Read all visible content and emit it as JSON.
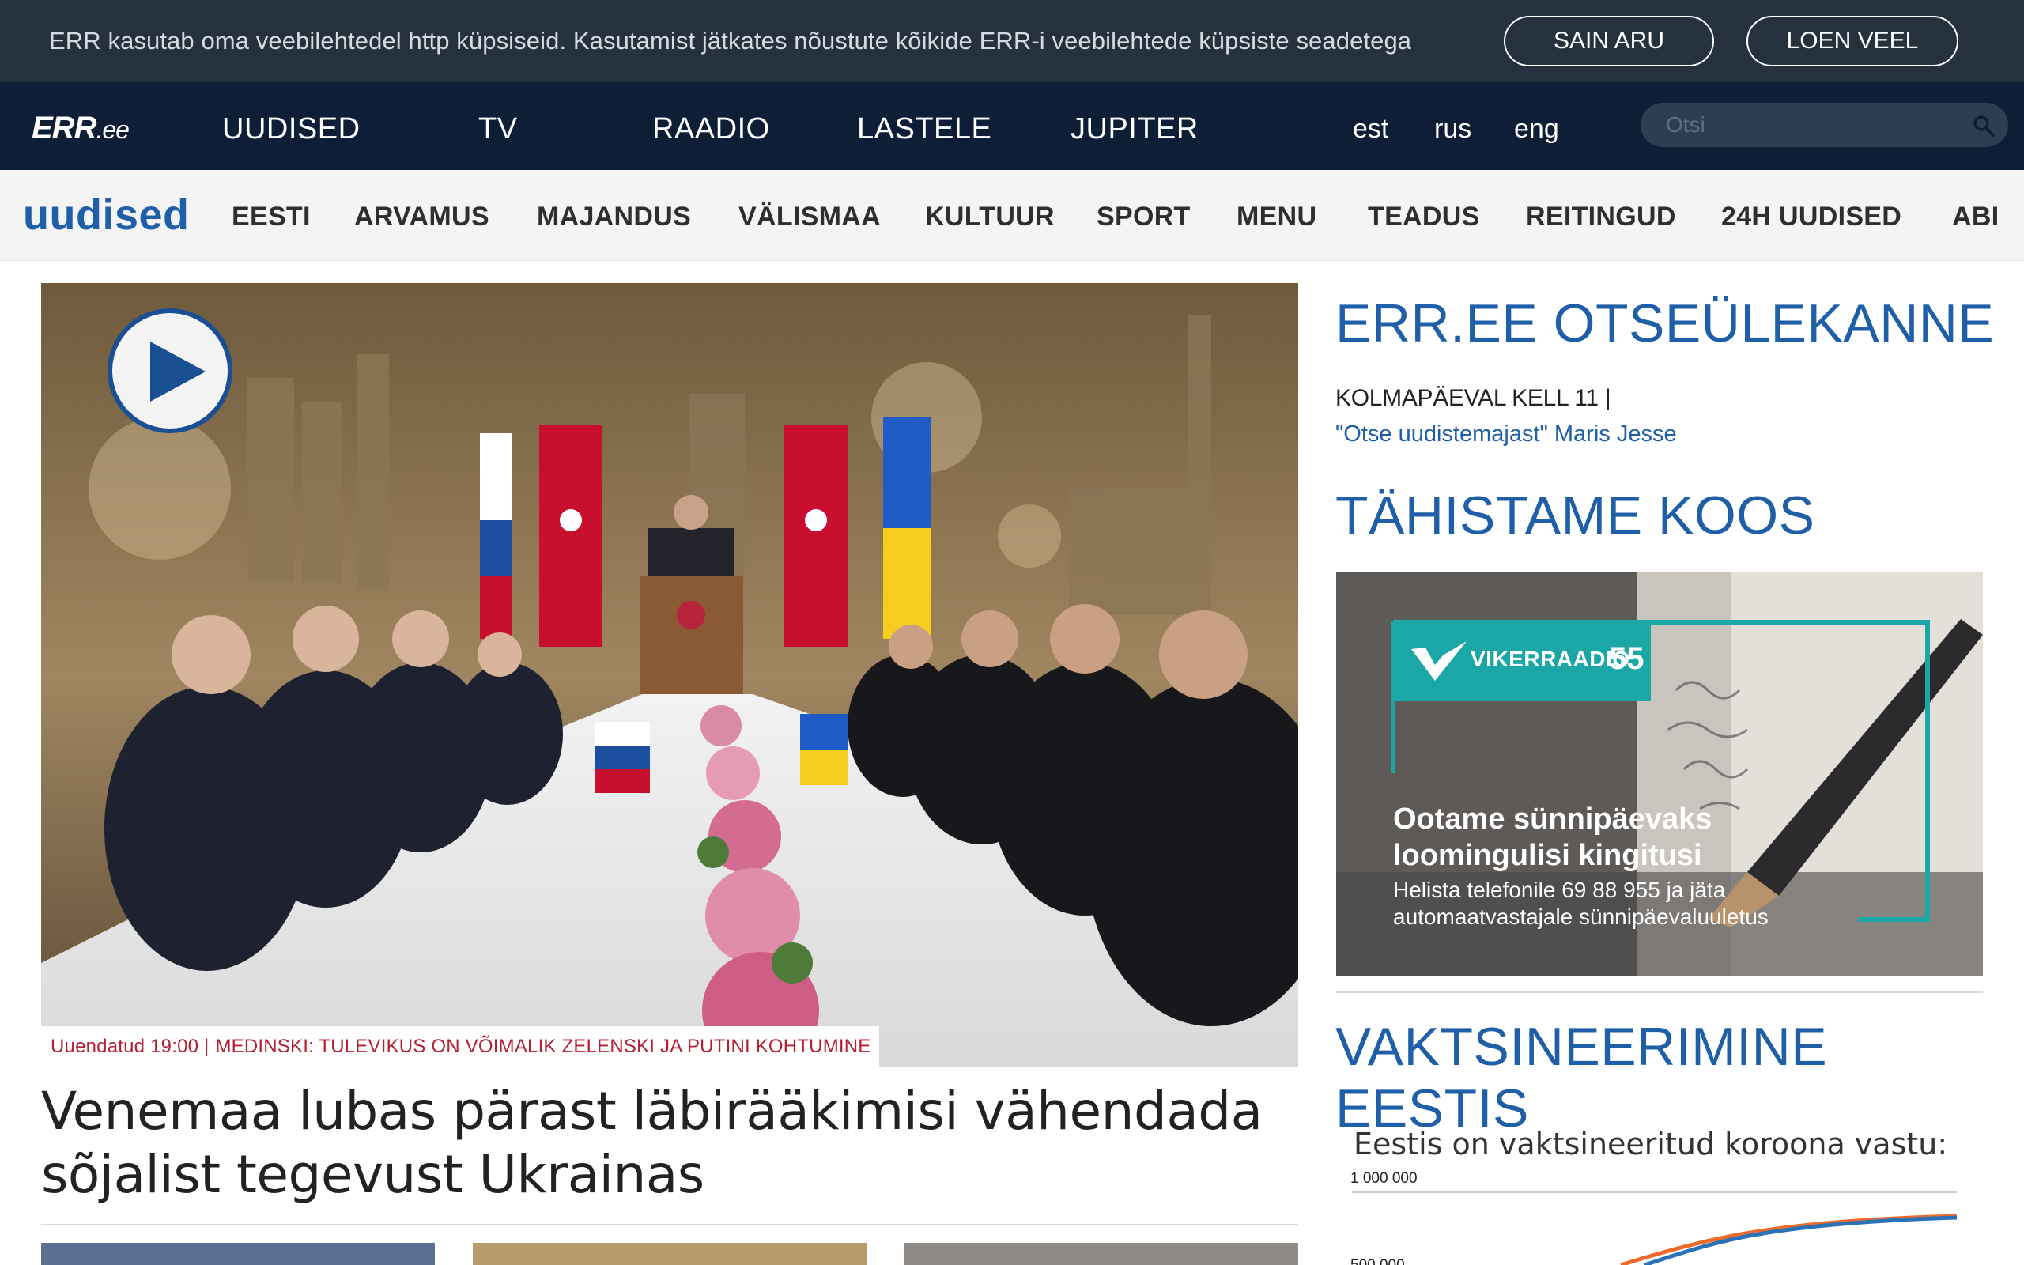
{
  "cookie_bar": {
    "text": "ERR kasutab oma veebilehtedel http küpsiseid. Kasutamist jätkates nõustute kõikide ERR-i veebilehtede küpsiste seadetega",
    "accept_label": "SAIN ARU",
    "more_label": "LOEN VEEL"
  },
  "top_nav": {
    "logo": "ERR",
    "logo_suffix": ".ee",
    "items": [
      "UUDISED",
      "TV",
      "RAADIO",
      "LASTELE",
      "JUPITER"
    ],
    "languages": [
      "est",
      "rus",
      "eng"
    ],
    "search_placeholder": "Otsi"
  },
  "section_nav": {
    "title": "uudised",
    "items": [
      "EESTI",
      "ARVAMUS",
      "MAJANDUS",
      "VÄLISMAA",
      "KULTUUR",
      "SPORT",
      "MENU",
      "TEADUS",
      "REITINGUD",
      "24H UUDISED",
      "ABI"
    ]
  },
  "main_article": {
    "caption_prefix": "Uuendatud 19:00 |",
    "caption_text": "MEDINSKI: TULEVIKUS ON VÕIMALIK ZELENSKI JA PUTINI KOHTUMINE",
    "headline": "Venemaa lubas pärast läbirääkimisi vähendada sõjalist tegevust Ukrainas"
  },
  "sidebar": {
    "live_title": "ERR.EE OTSEÜLEKANNE",
    "live_when": "KOLMAPÄEVAL KELL 11 |",
    "live_link": "\"Otse uudistemajast\" Maris Jesse",
    "celebrate_title": "TÄHISTAME KOOS",
    "promo": {
      "brand": "VIKERRAADIO",
      "brand_number": "55",
      "heading_line1": "Ootame sünnipäevaks",
      "heading_line2": "loomingulisi kingitusi",
      "text_line1": "Helista telefonile 69 88 955 ja jäta",
      "text_line2": "automaatvastajale sünnipäevaluuletus"
    },
    "vax_title": "VAKTSINEERIMINE EESTIS",
    "vax_subtitle": "Eestis on vaktsineeritud koroona vastu:",
    "vax_tick_top": "1 000 000",
    "vax_tick_mid": "500 000"
  },
  "colors": {
    "cookie_bg": "#25313d",
    "nav_bg": "#0e1e36",
    "accent_blue": "#1f5fa8",
    "caption_red": "#b51f34",
    "promo_teal": "#1aa7a5"
  }
}
